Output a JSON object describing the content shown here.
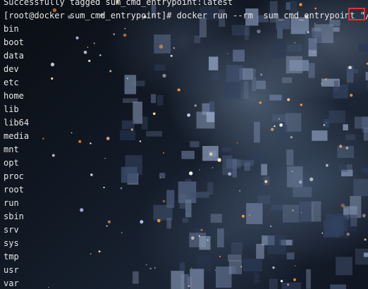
{
  "terminal": {
    "previous_line": "Successfully tagged sum_cmd_entrypoint:latest",
    "prompt": "[root@docker sum_cmd_entrypoint]# ",
    "command": "docker run --rm  sum_cmd_entrypoint ",
    "argument": "\"/\"",
    "output": [
      "bin",
      "boot",
      "data",
      "dev",
      "etc",
      "home",
      "lib",
      "lib64",
      "media",
      "mnt",
      "opt",
      "proc",
      "root",
      "run",
      "sbin",
      "srv",
      "sys",
      "tmp",
      "usr",
      "var"
    ]
  },
  "colors": {
    "text": "#e6e6e6",
    "highlight_border": "#e23232",
    "background_dark": "#0b0f16",
    "background_light": "#8a9ab0"
  }
}
